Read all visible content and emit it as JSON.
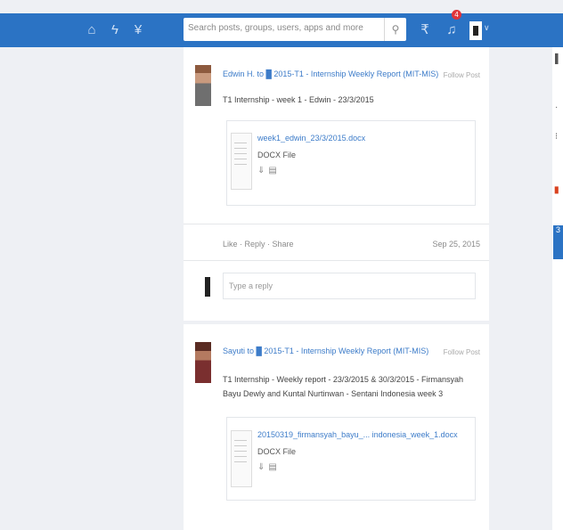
{
  "topnav": {
    "icons": [
      "home-icon",
      "activity-icon",
      "wheat-icon"
    ],
    "search_placeholder": "Search posts, groups, users, apps and more",
    "search_icon": "magnifier",
    "notification_count": "4",
    "colors": {
      "bar": "#2b73c4",
      "badge": "#e0343a",
      "link": "#3d7cc9"
    }
  },
  "posts": [
    {
      "title": "Edwin H. to █ 2015-T1 - Internship Weekly Report (MIT-MIS)",
      "follow": "Follow Post",
      "body": "T1 Internship - week 1 - Edwin - 23/3/2015",
      "attachment": {
        "name": "week1_edwin_23/3/2015.docx",
        "type": "DOCX File"
      },
      "actions": "Like · Reply · Share",
      "date": "Sep 25, 2015",
      "reply_placeholder": "Type a reply"
    },
    {
      "title": "Sayuti to █ 2015-T1 - Internship Weekly Report (MIT-MIS)",
      "follow": "Follow Post",
      "body": "T1 Internship - Weekly report - 23/3/2015 & 30/3/2015 - Firmansyah Bayu Dewly and Kuntal Nurtinwan - Sentani Indonesia week 3",
      "attachment": {
        "name": "20150319_firmansyah_bayu_... indonesia_week_1.docx",
        "type": "DOCX File"
      }
    }
  ]
}
